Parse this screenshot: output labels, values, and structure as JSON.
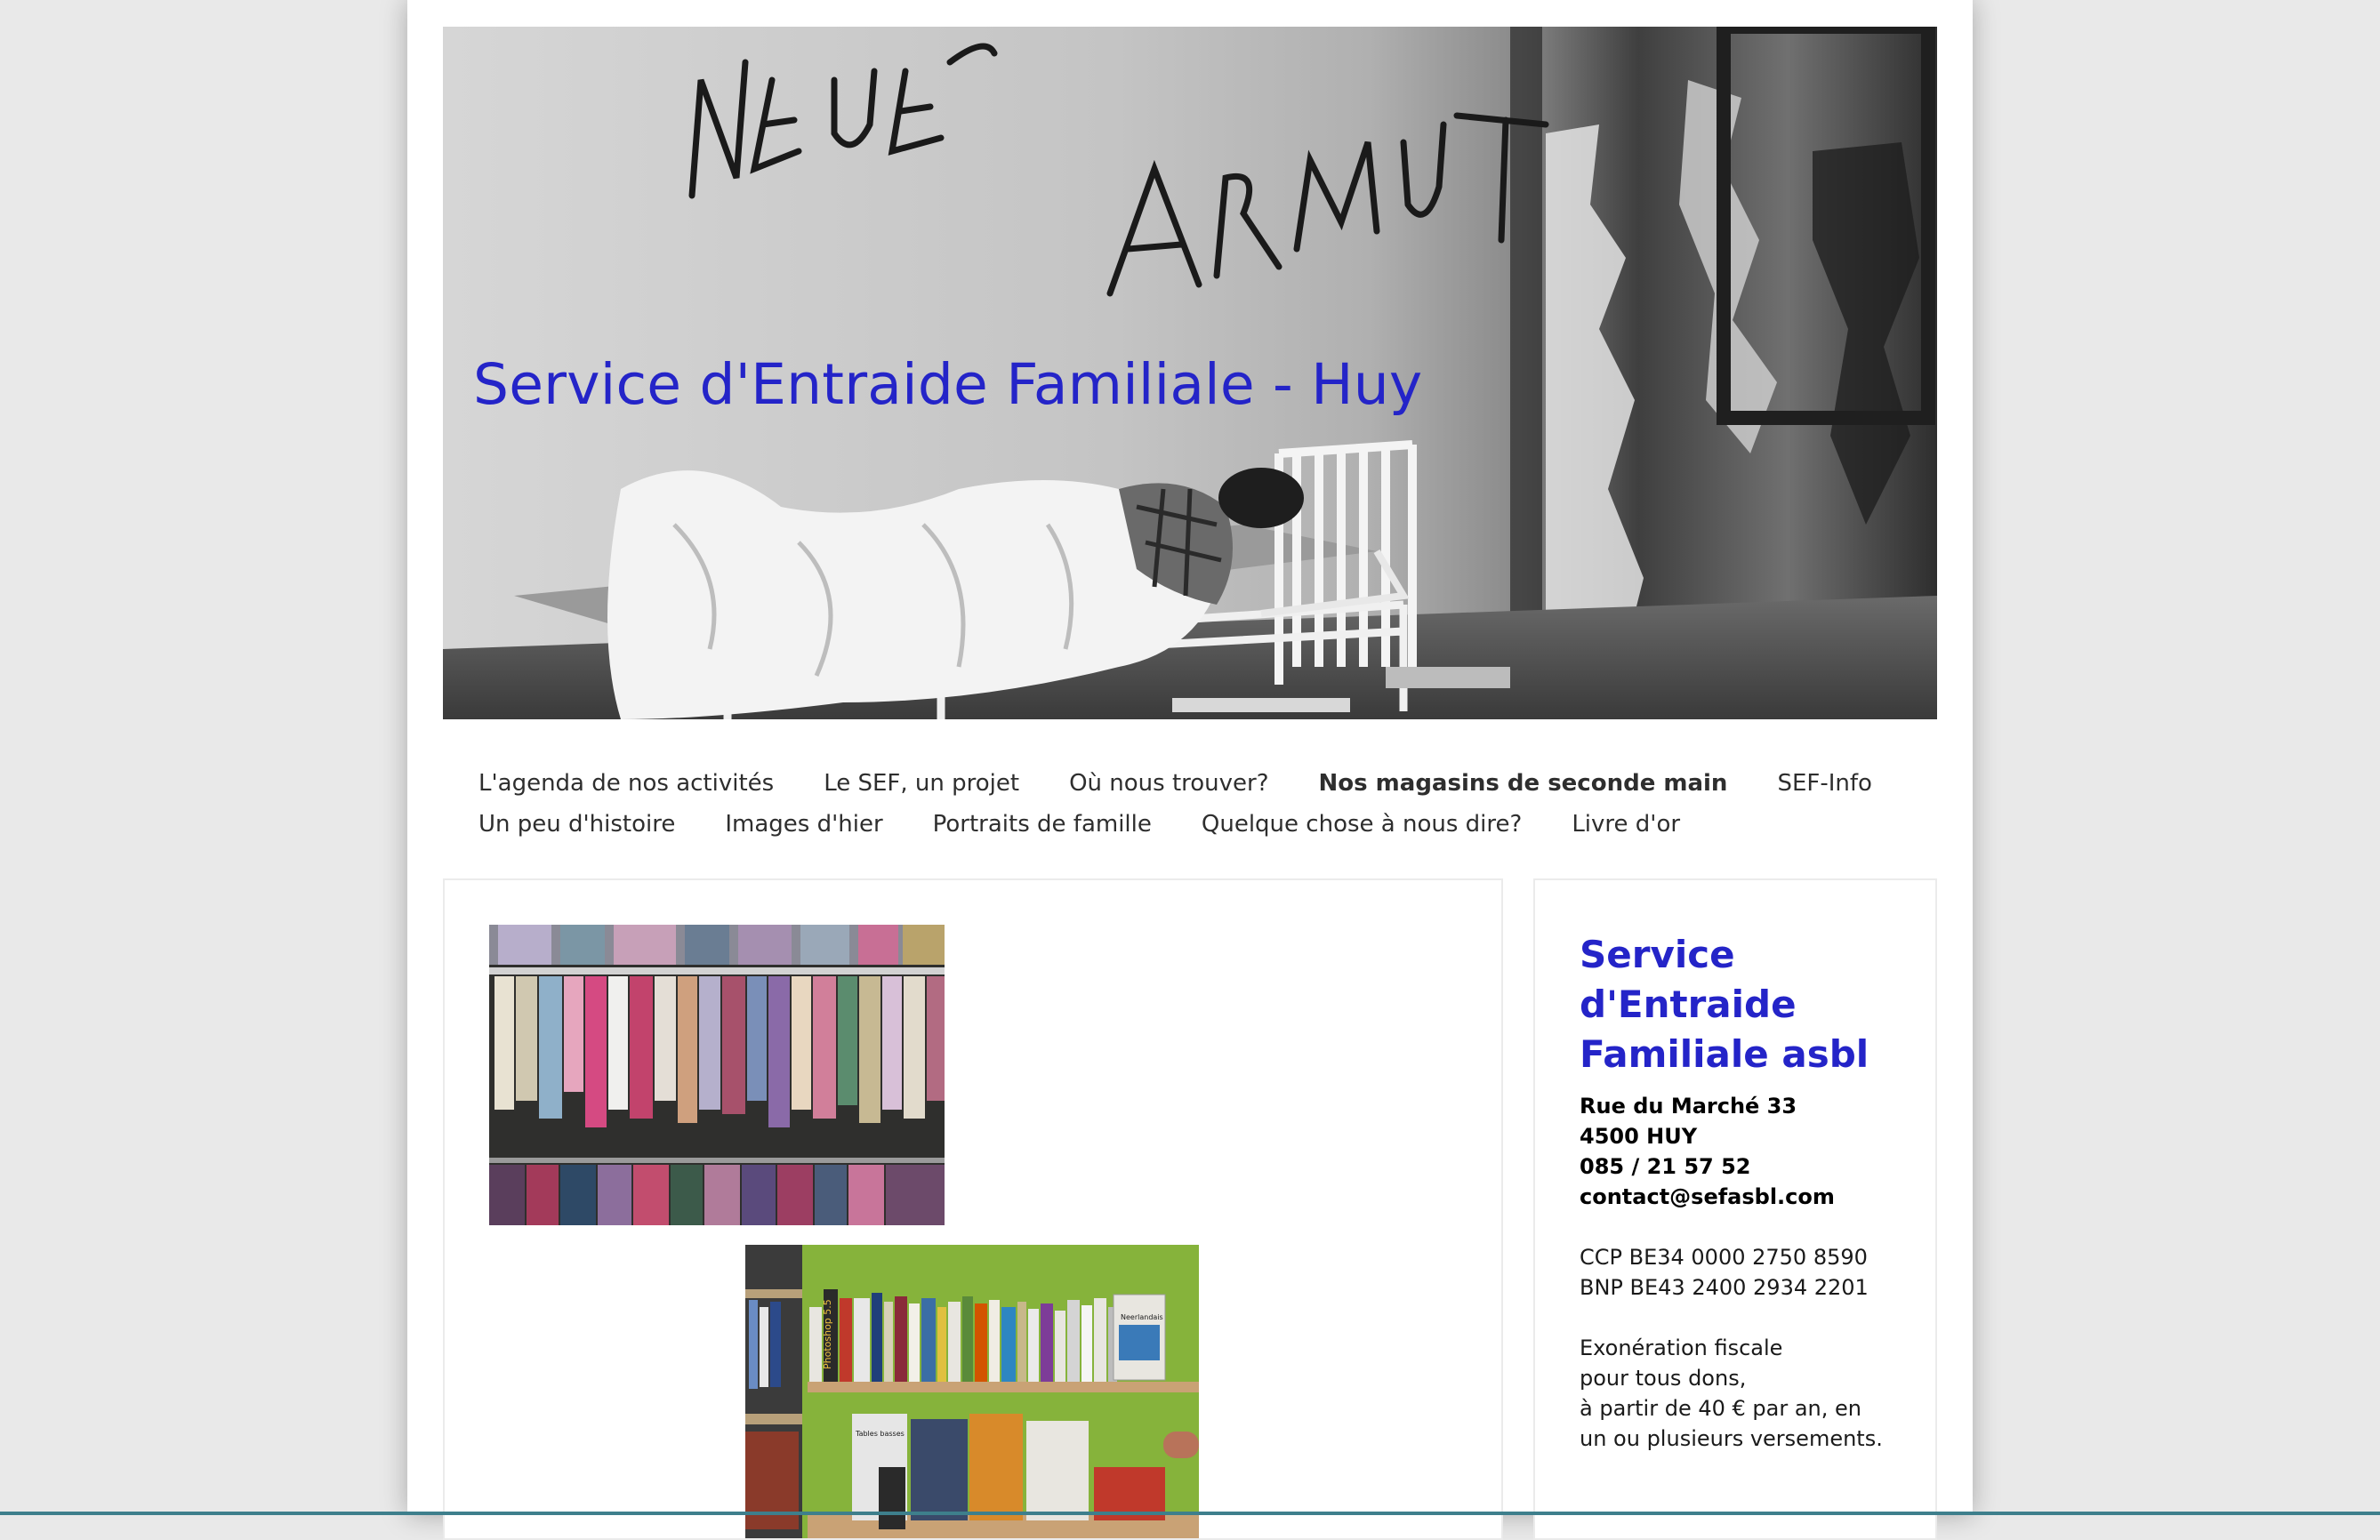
{
  "header": {
    "site_title": "Service d'Entraide Familiale - Huy",
    "banner_graffiti": "NEUE ARMUT"
  },
  "nav": {
    "row1": [
      {
        "label": "L'agenda de nos activités",
        "active": false
      },
      {
        "label": "Le SEF, un projet",
        "active": false
      },
      {
        "label": "Où nous trouver?",
        "active": false
      },
      {
        "label": "Nos magasins de seconde main",
        "active": true
      },
      {
        "label": "SEF-Info",
        "active": false
      }
    ],
    "row2": [
      {
        "label": "Un peu d'histoire",
        "active": false
      },
      {
        "label": "Images d'hier",
        "active": false
      },
      {
        "label": "Portraits de famille",
        "active": false
      },
      {
        "label": "Quelque chose à nous dire?",
        "active": false
      },
      {
        "label": "Livre d'or",
        "active": false
      }
    ]
  },
  "sidebar": {
    "title": "Service d'Entraide Familiale asbl",
    "address_street": "Rue du Marché 33",
    "address_city": "4500 HUY",
    "phone": "085 / 21 57 52",
    "email": "contact@sefasbl.com",
    "ccp": "CCP BE34 0000 2750 8590",
    "bnp": "BNP BE43 2400 2934 2201",
    "tax_1": "Exonération fiscale",
    "tax_2": "pour tous dons,",
    "tax_3": "à partir de 40 € par an, en",
    "tax_4": "un ou plusieurs versements."
  },
  "book_spines": {
    "photoshop": "Photoshop 5.5",
    "neerlandais": "Neerlandais",
    "tables": "Tables basses"
  }
}
